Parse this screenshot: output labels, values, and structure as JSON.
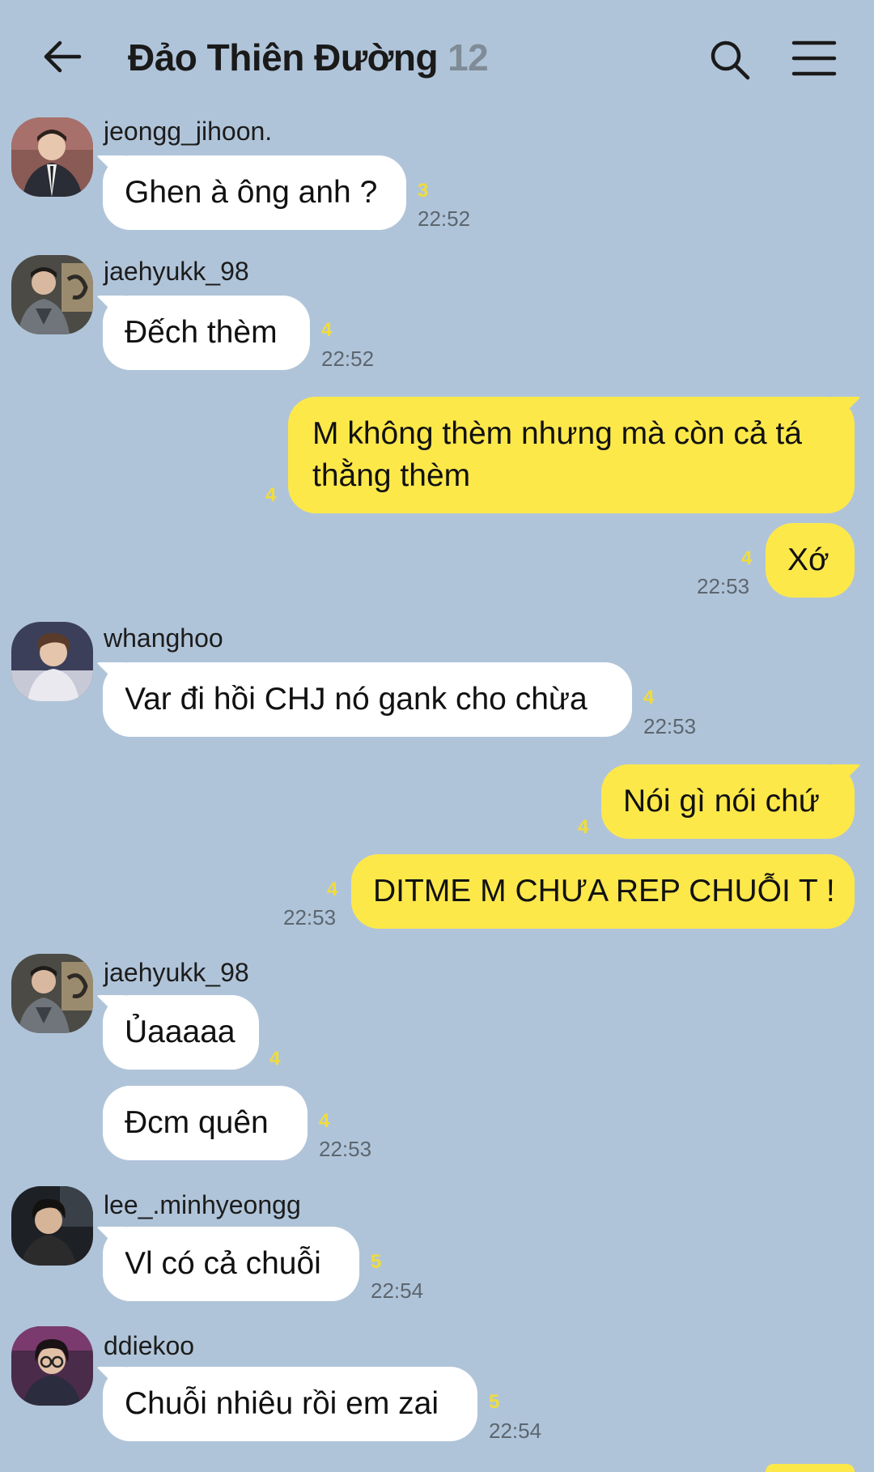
{
  "header": {
    "title": "Đảo Thiên Đường",
    "member_count": "12",
    "icons": [
      "back-arrow-icon",
      "search-icon",
      "menu-icon"
    ]
  },
  "colors": {
    "background": "#b0c4d9",
    "incoming_bubble": "#ffffff",
    "outgoing_bubble": "#fde84a",
    "unread_count": "#f0dc3c"
  },
  "messages": [
    {
      "sender": "jeongg_jihoon.",
      "text": "Ghen à ông anh ?",
      "unread": "3",
      "time": "22:52"
    },
    {
      "sender": "jaehyukk_98",
      "text": "Đếch thèm",
      "unread": "4",
      "time": "22:52"
    },
    {
      "sender": "me",
      "text": "M không thèm nhưng mà còn cả tá thằng thèm",
      "unread": "4"
    },
    {
      "sender": "me",
      "text": "Xớ",
      "unread": "4",
      "time": "22:53"
    },
    {
      "sender": "whanghoo",
      "text": "Var đi hồi CHJ nó gank cho chừa",
      "unread": "4",
      "time": "22:53"
    },
    {
      "sender": "me",
      "text": "Nói gì nói chứ",
      "unread": "4"
    },
    {
      "sender": "me",
      "text": "DITME M CHƯA REP CHUỖI T !",
      "unread": "4",
      "time": "22:53"
    },
    {
      "sender": "jaehyukk_98",
      "text": "Ủaaaaa",
      "unread": "4"
    },
    {
      "sender": "jaehyukk_98",
      "text": "Đcm quên",
      "unread": "4",
      "time": "22:53"
    },
    {
      "sender": "lee_.minhyeongg",
      "text": "Vl có cả chuỗi",
      "unread": "5",
      "time": "22:54"
    },
    {
      "sender": "ddiekoo",
      "text": "Chuỗi nhiêu rồi em zai",
      "unread": "5",
      "time": "22:54"
    }
  ]
}
